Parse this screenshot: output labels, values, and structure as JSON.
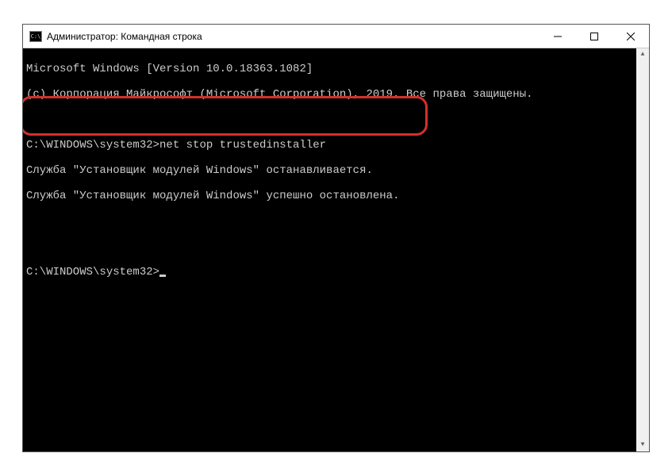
{
  "window": {
    "title": "Администратор: Командная строка"
  },
  "terminal": {
    "line1": "Microsoft Windows [Version 10.0.18363.1082]",
    "line2": "(c) Корпорация Майкрософт (Microsoft Corporation), 2019. Все права защищены.",
    "blank1": "",
    "prompt1": "C:\\WINDOWS\\system32>",
    "command1": "net stop trustedinstaller",
    "output1": "Служба \"Установщик модулей Windows\" останавливается.",
    "output2": "Служба \"Установщик модулей Windows\" успешно остановлена.",
    "blank2": "",
    "blank3": "",
    "prompt2": "C:\\WINDOWS\\system32>"
  }
}
